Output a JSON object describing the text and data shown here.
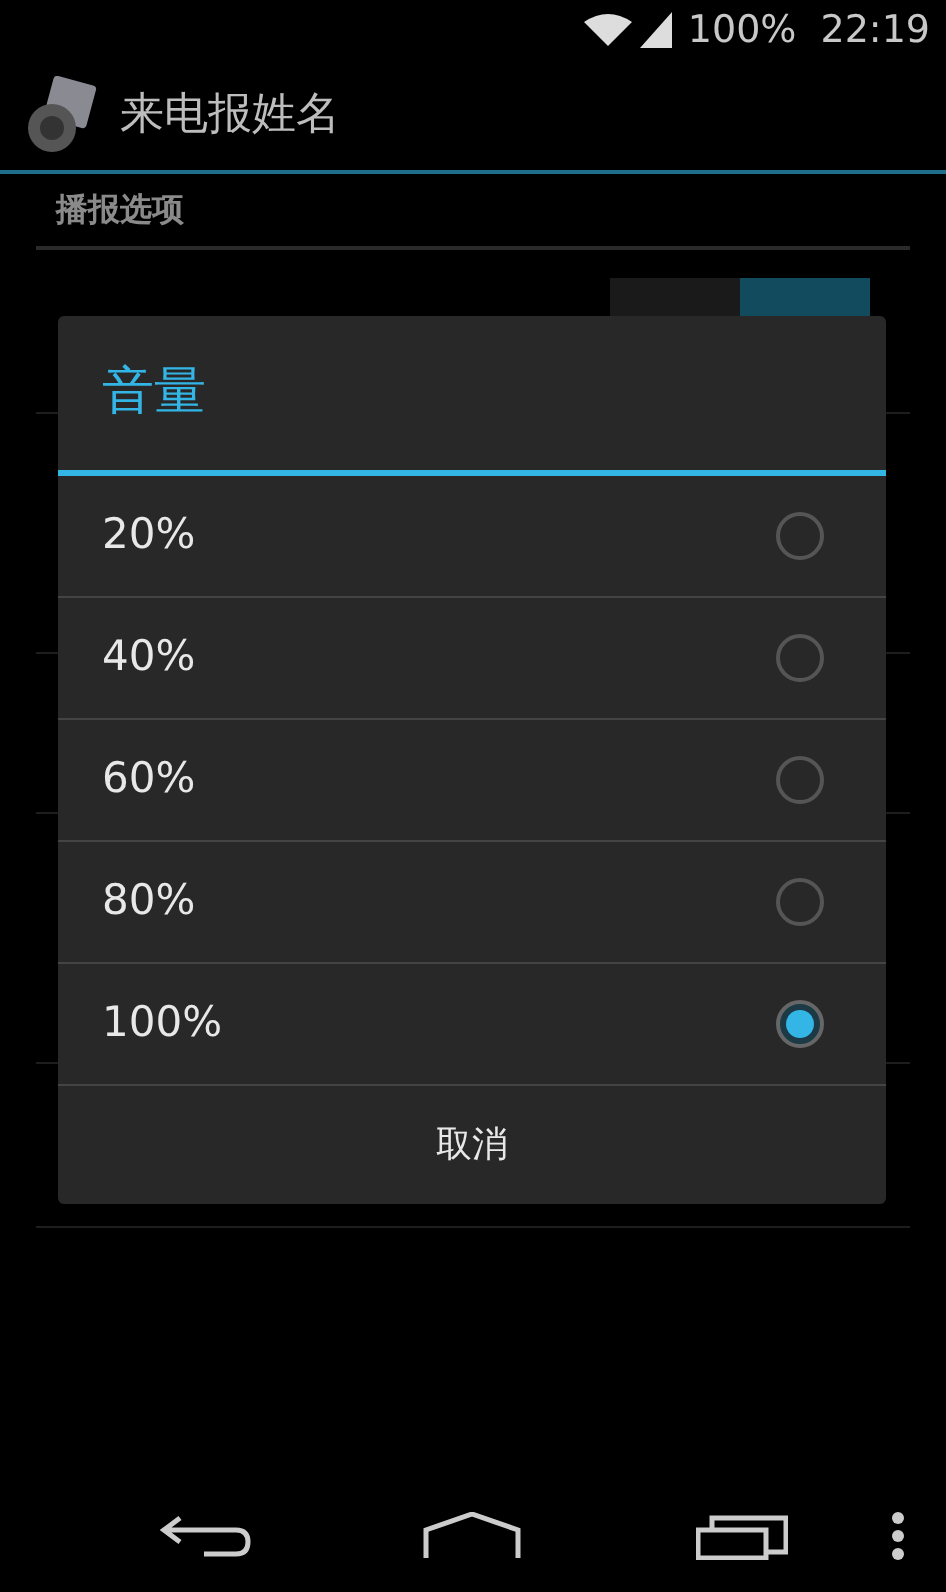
{
  "status_bar": {
    "battery": "100%",
    "time": "22:19"
  },
  "action_bar": {
    "title": "来电报姓名"
  },
  "preferences": {
    "category": "播报选项",
    "items": [
      {
        "on": true
      }
    ]
  },
  "dialog": {
    "title": "音量",
    "options": [
      {
        "label": "20%",
        "selected": false
      },
      {
        "label": "40%",
        "selected": false
      },
      {
        "label": "60%",
        "selected": false
      },
      {
        "label": "80%",
        "selected": false
      },
      {
        "label": "100%",
        "selected": true
      }
    ],
    "cancel": "取消"
  }
}
